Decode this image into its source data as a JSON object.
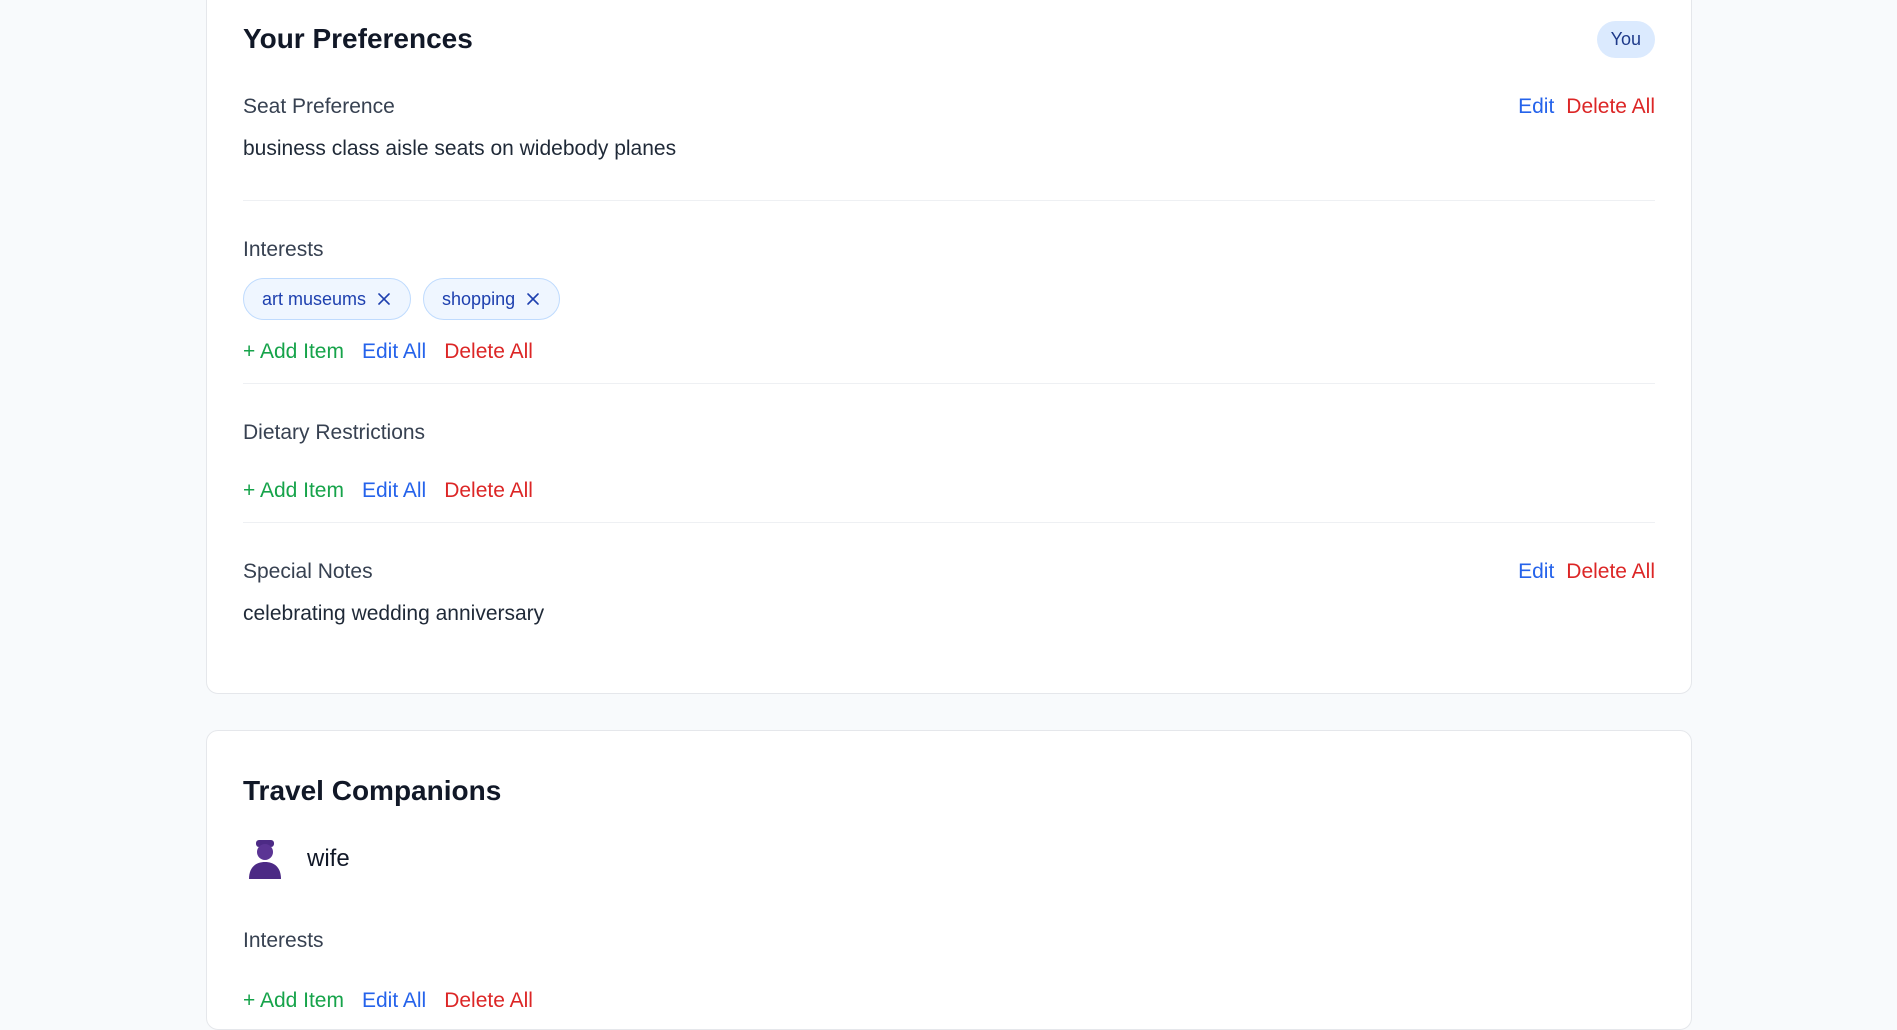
{
  "preferences": {
    "title": "Your Preferences",
    "badge": "You",
    "seat": {
      "label": "Seat Preference",
      "value": "business class aisle seats on widebody planes",
      "edit": "Edit",
      "delete": "Delete All"
    },
    "interests": {
      "label": "Interests",
      "items": [
        "art museums",
        "shopping"
      ],
      "add": "+ Add Item",
      "edit_all": "Edit All",
      "delete_all": "Delete All"
    },
    "dietary": {
      "label": "Dietary Restrictions",
      "add": "+ Add Item",
      "edit_all": "Edit All",
      "delete_all": "Delete All"
    },
    "notes": {
      "label": "Special Notes",
      "value": "celebrating wedding anniversary",
      "edit": "Edit",
      "delete": "Delete All"
    }
  },
  "companions": {
    "title": "Travel Companions",
    "items": [
      {
        "name": "wife",
        "icon": "person-avatar-icon",
        "interests": {
          "label": "Interests",
          "add": "+ Add Item",
          "edit_all": "Edit All",
          "delete_all": "Delete All"
        }
      }
    ]
  },
  "colors": {
    "blue": "#2563eb",
    "red": "#dc2626",
    "green": "#16a34a",
    "avatar": "#4c2a85"
  }
}
